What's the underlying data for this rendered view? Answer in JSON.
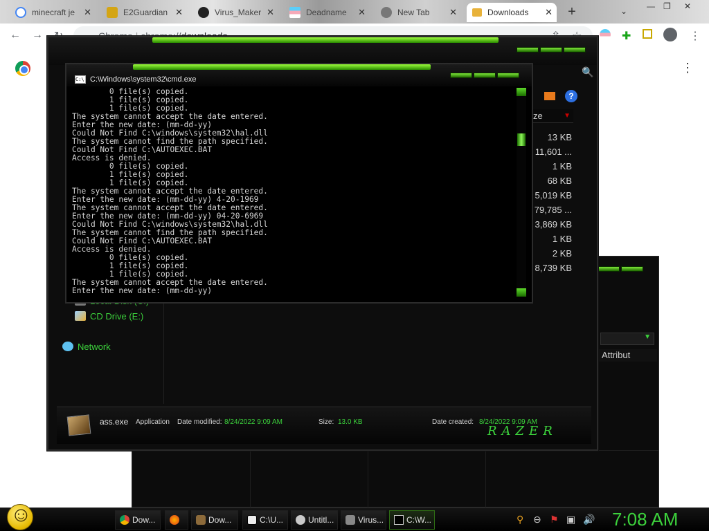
{
  "browser": {
    "tabs": [
      {
        "title": "minecraft je"
      },
      {
        "title": "E2Guardian"
      },
      {
        "title": "Virus_Maker"
      },
      {
        "title": "Deadname"
      },
      {
        "title": "New Tab"
      },
      {
        "title": "Downloads"
      }
    ],
    "new_tab_symbol": "+",
    "close_symbol": "✕",
    "omnibox": {
      "site_label": "Chrome",
      "url_prefix": "chrome://",
      "url_host": "downloads"
    }
  },
  "explorer": {
    "column_header": "ze",
    "sizes": [
      "13 KB",
      "11,601 ...",
      "1 KB",
      "68 KB",
      "5,019 KB",
      "79,785 ...",
      "3,869 KB",
      "1 KB",
      "2 KB",
      "8,739 KB"
    ],
    "nav": [
      {
        "label": "Local Disk (C:)"
      },
      {
        "label": "CD Drive (E:)"
      },
      {
        "label": "Network"
      }
    ],
    "details": {
      "filename": "ass.exe",
      "type": "Application",
      "modified_label": "Date modified:",
      "modified_value": "8/24/2022 9:09 AM",
      "size_label": "Size:",
      "size_value": "13.0 KB",
      "created_label": "Date created:",
      "created_value": "8/24/2022 9:09 AM"
    },
    "brand": "RAZER"
  },
  "explorer2": {
    "column_header": "Attribut"
  },
  "cmd": {
    "title": "C:\\Windows\\system32\\cmd.exe",
    "icon_text": "C:\\",
    "lines": [
      "        0 file(s) copied.",
      "        1 file(s) copied.",
      "        1 file(s) copied.",
      "The system cannot accept the date entered.",
      "Enter the new date: (mm-dd-yy)",
      "Could Not Find C:\\windows\\system32\\hal.dll",
      "The system cannot find the path specified.",
      "Could Not Find C:\\AUTOEXEC.BAT",
      "Access is denied.",
      "        0 file(s) copied.",
      "        1 file(s) copied.",
      "        1 file(s) copied.",
      "The system cannot accept the date entered.",
      "Enter the new date: (mm-dd-yy) 4-20-1969",
      "The system cannot accept the date entered.",
      "Enter the new date: (mm-dd-yy) 04-20-6969",
      "Could Not Find C:\\windows\\system32\\hal.dll",
      "The system cannot find the path specified.",
      "Could Not Find C:\\AUTOEXEC.BAT",
      "Access is denied.",
      "        0 file(s) copied.",
      "        1 file(s) copied.",
      "        1 file(s) copied.",
      "The system cannot accept the date entered.",
      "Enter the new date: (mm-dd-yy)"
    ]
  },
  "taskbar": {
    "items": [
      {
        "label": "Dow...",
        "icon": "chrome-icon"
      },
      {
        "label": "",
        "icon": "firefox-icon"
      },
      {
        "label": "Dow...",
        "icon": "downloads-folder-icon"
      },
      {
        "label": "C:\\U...",
        "icon": "7zip-icon"
      },
      {
        "label": "Untitl...",
        "icon": "paint-icon"
      },
      {
        "label": "Virus...",
        "icon": "virus-maker-icon"
      },
      {
        "label": "C:\\W...",
        "icon": "cmd-icon"
      }
    ],
    "clock": "7:08 AM"
  },
  "colors": {
    "accent_green": "#3cd23c",
    "cmd_background": "#000000"
  }
}
